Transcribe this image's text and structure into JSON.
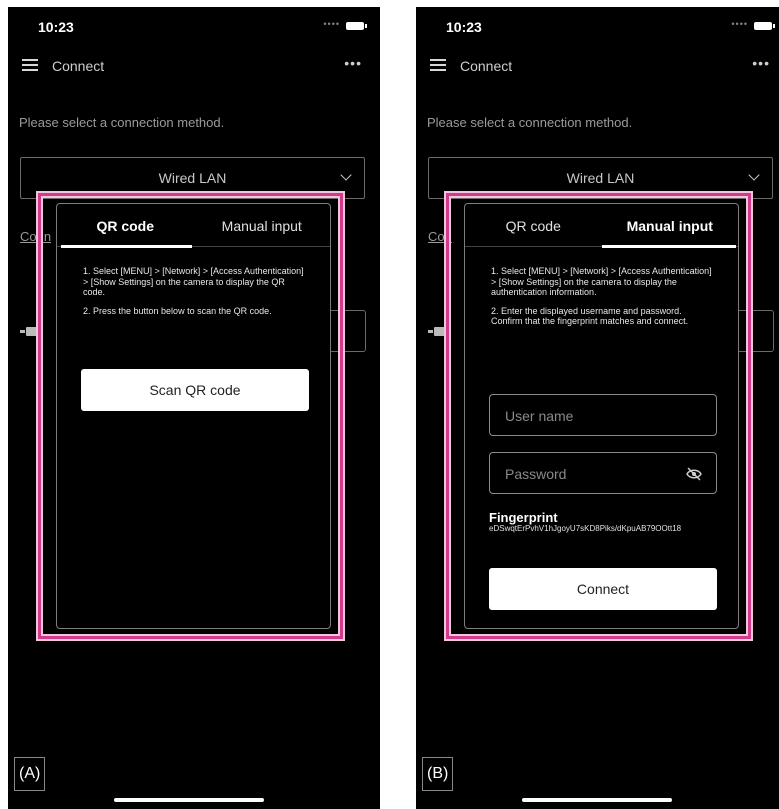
{
  "screens": [
    {
      "id": "A",
      "status_time": "10:23",
      "nav_title": "Connect",
      "prompt": "Please select a connection method.",
      "connection_method": "Wired LAN",
      "bg_fragment": "Conn",
      "tabs": [
        {
          "label": "QR code",
          "active": true
        },
        {
          "label": "Manual input",
          "active": false
        }
      ],
      "instructions": [
        "1. Select [MENU] > [Network] > [Access Authentication] > [Show Settings] on the camera to display the QR code.",
        "2. Press the button below to scan the QR code."
      ],
      "primary_button": "Scan QR code",
      "corner_label": "(A)"
    },
    {
      "id": "B",
      "status_time": "10:23",
      "nav_title": "Connect",
      "prompt": "Please select a connection method.",
      "connection_method": "Wired LAN",
      "bg_fragment": "Con",
      "tabs": [
        {
          "label": "QR code",
          "active": false
        },
        {
          "label": "Manual input",
          "active": true
        }
      ],
      "instructions": [
        "1. Select [MENU] > [Network] > [Access Authentication] > [Show Settings] on the camera to display the authentication information.",
        "2. Enter the displayed username and password. Confirm that the fingerprint matches and connect."
      ],
      "username_placeholder": "User name",
      "password_placeholder": "Password",
      "fingerprint_label": "Fingerprint",
      "fingerprint_value": "eDSwqtErPvhV1hJgoyU7sKD8Piks/dKpuAB79OOtt18",
      "primary_button": "Connect",
      "corner_label": "(B)"
    }
  ],
  "colors": {
    "background": "#000000",
    "highlight": "#d23a8c",
    "button_bg": "#ffffff"
  },
  "icons": [
    "menu-icon",
    "more-icon",
    "battery-icon",
    "chevron-down-icon",
    "eye-off-icon",
    "camera-icon"
  ]
}
